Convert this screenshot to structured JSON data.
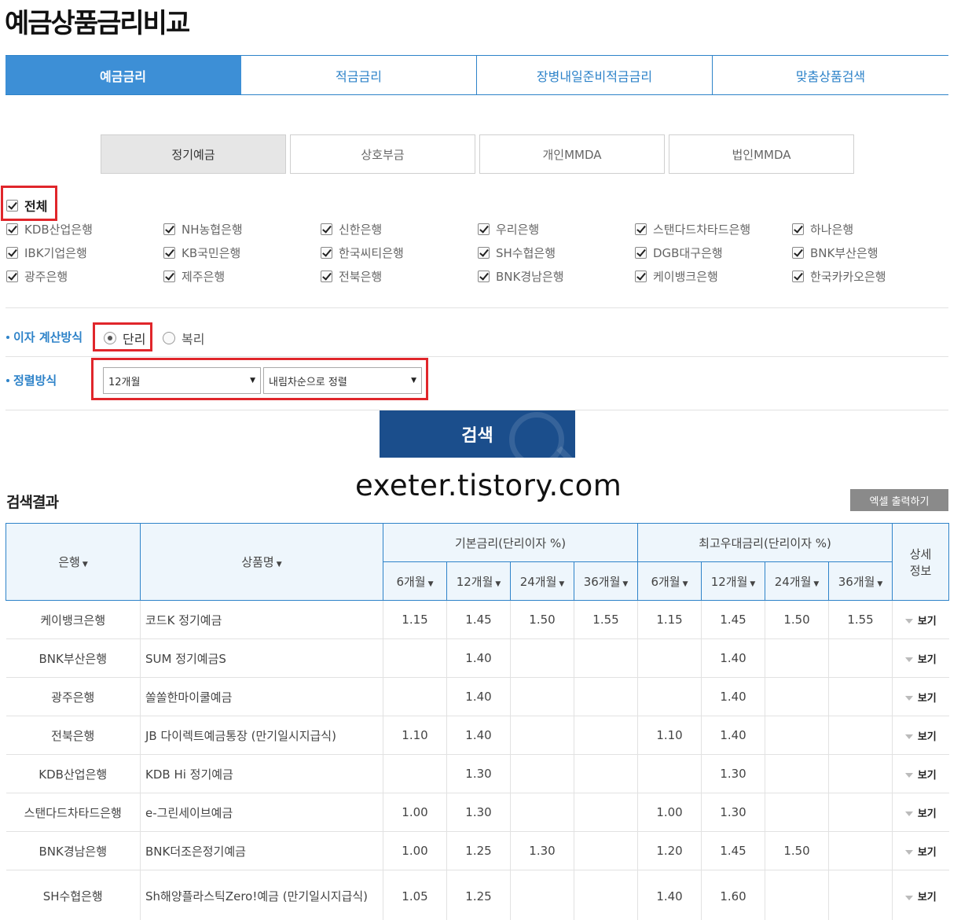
{
  "page_title": "예금상품금리비교",
  "top_tabs": [
    "예금금리",
    "적금금리",
    "장병내일준비적금금리",
    "맞춤상품검색"
  ],
  "sub_tabs": [
    "정기예금",
    "상호부금",
    "개인MMDA",
    "법인MMDA"
  ],
  "all_label": "전체",
  "banks": [
    [
      "KDB산업은행",
      "NH농협은행",
      "신한은행",
      "우리은행",
      "스탠다드차타드은행",
      "하나은행"
    ],
    [
      "IBK기업은행",
      "KB국민은행",
      "한국씨티은행",
      "SH수협은행",
      "DGB대구은행",
      "BNK부산은행"
    ],
    [
      "광주은행",
      "제주은행",
      "전북은행",
      "BNK경남은행",
      "케이뱅크은행",
      "한국카카오은행"
    ]
  ],
  "interest": {
    "label": "이자 계산방식",
    "options": [
      "단리",
      "복리"
    ],
    "selected": "단리"
  },
  "sort": {
    "label": "정렬방식",
    "period": "12개월",
    "order": "내림차순으로 정렬"
  },
  "search_button": "검색",
  "watermark": "exeter.tistory.com",
  "result_title": "검색결과",
  "excel_button": "엑셀 출력하기",
  "table": {
    "col_bank": "은행",
    "col_product": "상품명",
    "group_base": "기본금리(단리이자 %)",
    "group_max": "최고우대금리(단리이자 %)",
    "col_detail_1": "상세",
    "col_detail_2": "정보",
    "periods": [
      "6개월",
      "12개월",
      "24개월",
      "36개월"
    ],
    "view_label": "보기",
    "rows": [
      {
        "bank": "케이뱅크은행",
        "product": "코드K 정기예금",
        "base": [
          "1.15",
          "1.45",
          "1.50",
          "1.55"
        ],
        "max": [
          "1.15",
          "1.45",
          "1.50",
          "1.55"
        ]
      },
      {
        "bank": "BNK부산은행",
        "product": "SUM 정기예금S",
        "base": [
          "",
          "1.40",
          "",
          ""
        ],
        "max": [
          "",
          "1.40",
          "",
          ""
        ]
      },
      {
        "bank": "광주은행",
        "product": "쏠쏠한마이쿨예금",
        "base": [
          "",
          "1.40",
          "",
          ""
        ],
        "max": [
          "",
          "1.40",
          "",
          ""
        ]
      },
      {
        "bank": "전북은행",
        "product": "JB 다이렉트예금통장 (만기일시지급식)",
        "base": [
          "1.10",
          "1.40",
          "",
          ""
        ],
        "max": [
          "1.10",
          "1.40",
          "",
          ""
        ]
      },
      {
        "bank": "KDB산업은행",
        "product": "KDB Hi 정기예금",
        "base": [
          "",
          "1.30",
          "",
          ""
        ],
        "max": [
          "",
          "1.30",
          "",
          ""
        ]
      },
      {
        "bank": "스탠다드차타드은행",
        "product": "e-그린세이브예금",
        "base": [
          "1.00",
          "1.30",
          "",
          ""
        ],
        "max": [
          "1.00",
          "1.30",
          "",
          ""
        ]
      },
      {
        "bank": "BNK경남은행",
        "product": "BNK더조은정기예금",
        "base": [
          "1.00",
          "1.25",
          "1.30",
          ""
        ],
        "max": [
          "1.20",
          "1.45",
          "1.50",
          ""
        ]
      },
      {
        "bank": "SH수협은행",
        "product": "Sh해양플라스틱Zero!예금 (만기일시지급식)",
        "base": [
          "1.05",
          "1.25",
          "",
          ""
        ],
        "max": [
          "1.40",
          "1.60",
          "",
          ""
        ]
      }
    ]
  }
}
